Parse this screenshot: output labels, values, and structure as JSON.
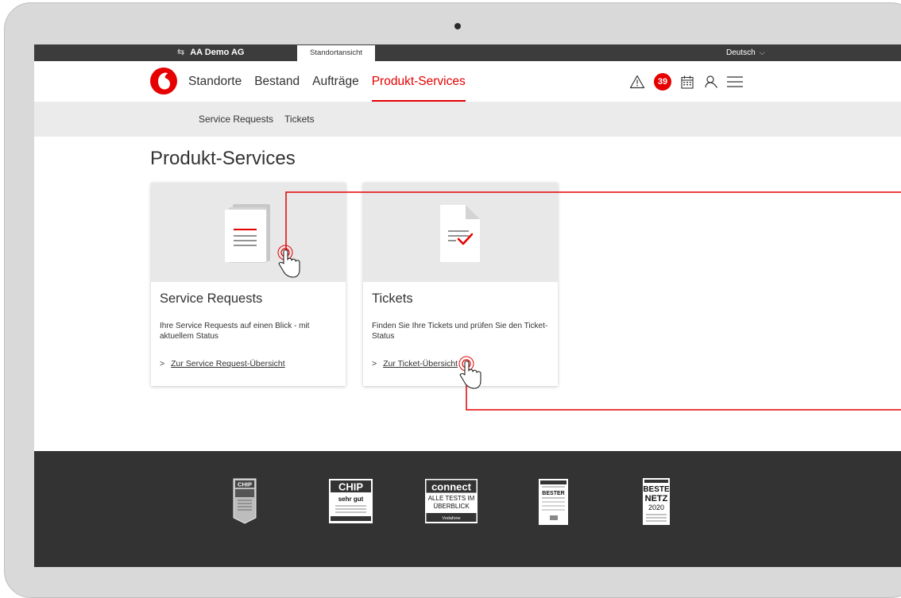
{
  "topbar": {
    "company": "AA Demo AG",
    "view_tab": "Standortansicht",
    "language": "Deutsch"
  },
  "nav": {
    "items": [
      "Standorte",
      "Bestand",
      "Aufträge",
      "Produkt-Services"
    ],
    "active": "Produkt-Services",
    "notification_count": "39"
  },
  "subnav": {
    "items": [
      "Service Requests",
      "Tickets"
    ]
  },
  "page": {
    "title": "Produkt-Services"
  },
  "cards": [
    {
      "title": "Service Requests",
      "description": "Ihre Service Requests auf einen Blick - mit aktuellem Status",
      "link": "Zur Service Request-Übersicht"
    },
    {
      "title": "Tickets",
      "description": "Finden Sie Ihre Tickets und prüfen Sie den Ticket-Status",
      "link": "Zur Ticket-Übersicht"
    }
  ],
  "awards": [
    {
      "name": "chip-award-badge",
      "lines": [
        "CHIP"
      ]
    },
    {
      "name": "chip-sehr-gut-badge",
      "lines": [
        "CHIP",
        "sehr gut"
      ]
    },
    {
      "name": "connect-badge",
      "lines": [
        "connect",
        "ALLE TESTS IM",
        "ÜBERBLICK",
        "Vodafone"
      ]
    },
    {
      "name": "bester-mobilfunknetz-badge",
      "lines": [
        "BESTER"
      ]
    },
    {
      "name": "bestes-netz-badge",
      "lines": [
        "BESTE",
        "NETZ",
        "2020"
      ]
    }
  ],
  "colors": {
    "brand_red": "#e60000",
    "topbar": "#3c3c3c",
    "subnav": "#ebebeb",
    "footer": "#333333",
    "card_banner": "#e8e8e8",
    "laptop_frame": "#d9d9d9"
  }
}
